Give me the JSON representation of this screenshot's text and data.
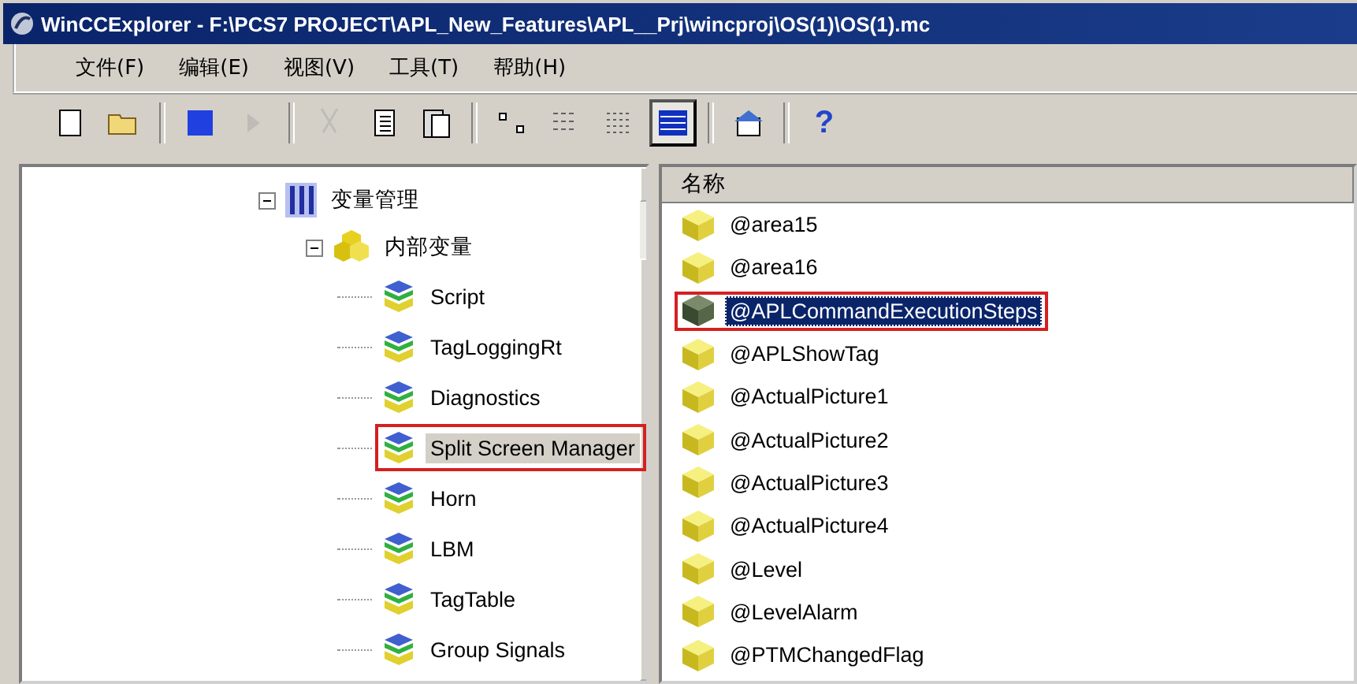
{
  "window": {
    "title": "WinCCExplorer - F:\\PCS7 PROJECT\\APL_New_Features\\APL__Prj\\wincproj\\OS(1)\\OS(1).mc"
  },
  "menu": [
    "文件(F)",
    "编辑(E)",
    "视图(V)",
    "工具(T)",
    "帮助(H)"
  ],
  "toolbar": [
    {
      "kind": "new",
      "disabled": false,
      "pressed": false
    },
    {
      "kind": "open",
      "disabled": false,
      "pressed": false
    },
    {
      "kind": "sep"
    },
    {
      "kind": "stop",
      "disabled": false,
      "pressed": false
    },
    {
      "kind": "run",
      "disabled": true,
      "pressed": false
    },
    {
      "kind": "sep"
    },
    {
      "kind": "cut",
      "disabled": true,
      "pressed": false
    },
    {
      "kind": "copy",
      "disabled": false,
      "pressed": false
    },
    {
      "kind": "paste",
      "disabled": false,
      "pressed": false
    },
    {
      "kind": "sep"
    },
    {
      "kind": "large",
      "disabled": false,
      "pressed": false
    },
    {
      "kind": "small",
      "disabled": false,
      "pressed": false
    },
    {
      "kind": "list",
      "disabled": false,
      "pressed": false
    },
    {
      "kind": "details",
      "disabled": false,
      "pressed": true
    },
    {
      "kind": "sep"
    },
    {
      "kind": "properties",
      "disabled": false,
      "pressed": false
    },
    {
      "kind": "sep"
    },
    {
      "kind": "help",
      "label": "?",
      "disabled": false,
      "pressed": false
    }
  ],
  "tree": [
    {
      "label": "变量管理",
      "kind": "manager",
      "expanded": true,
      "selected": false,
      "highlighted": false,
      "children": [
        {
          "label": "内部变量",
          "kind": "internal",
          "expanded": true,
          "selected": false,
          "highlighted": false,
          "children": [
            {
              "label": "Script",
              "kind": "group",
              "selected": false,
              "highlighted": false
            },
            {
              "label": "TagLoggingRt",
              "kind": "group",
              "selected": false,
              "highlighted": false
            },
            {
              "label": "Diagnostics",
              "kind": "group",
              "selected": false,
              "highlighted": false
            },
            {
              "label": "Split Screen Manager",
              "kind": "group",
              "selected": true,
              "highlighted": true
            },
            {
              "label": "Horn",
              "kind": "group",
              "selected": false,
              "highlighted": false
            },
            {
              "label": "LBM",
              "kind": "group",
              "selected": false,
              "highlighted": false
            },
            {
              "label": "TagTable",
              "kind": "group",
              "selected": false,
              "highlighted": false
            },
            {
              "label": "Group Signals",
              "kind": "group",
              "selected": false,
              "highlighted": false
            }
          ]
        }
      ]
    }
  ],
  "list": {
    "column": "名称",
    "rows": [
      {
        "name": "@area15",
        "selected": false,
        "highlighted": false
      },
      {
        "name": "@area16",
        "selected": false,
        "highlighted": false
      },
      {
        "name": "@APLCommandExecutionSteps",
        "selected": true,
        "highlighted": true
      },
      {
        "name": "@APLShowTag",
        "selected": false,
        "highlighted": false
      },
      {
        "name": "@ActualPicture1",
        "selected": false,
        "highlighted": false
      },
      {
        "name": "@ActualPicture2",
        "selected": false,
        "highlighted": false
      },
      {
        "name": "@ActualPicture3",
        "selected": false,
        "highlighted": false
      },
      {
        "name": "@ActualPicture4",
        "selected": false,
        "highlighted": false
      },
      {
        "name": "@Level",
        "selected": false,
        "highlighted": false
      },
      {
        "name": "@LevelAlarm",
        "selected": false,
        "highlighted": false
      },
      {
        "name": "@PTMChangedFlag",
        "selected": false,
        "highlighted": false
      }
    ]
  }
}
